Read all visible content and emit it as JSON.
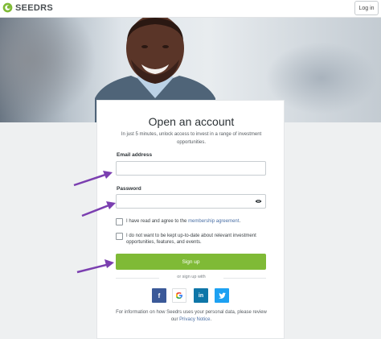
{
  "header": {
    "brand": "SEEDRS",
    "login_label": "Log in"
  },
  "form": {
    "title": "Open an account",
    "subtitle": "In just 5 minutes, unlock access to invest in a range of investment opportunities.",
    "email_label": "Email address",
    "email_value": "",
    "password_label": "Password",
    "password_value": "",
    "agree_text": "I have read and agree to the ",
    "agree_link": "membership agreement",
    "agree_end": ".",
    "optout_text": "I do not want to be kept up-to-date about relevant investment opportunities, features, and events.",
    "signup_label": "Sign up",
    "or_text": "or sign up with",
    "privacy_text": "For information on how Seedrs uses your personal data, please review our ",
    "privacy_link": "Privacy Notice",
    "privacy_end": "."
  },
  "social": {
    "facebook": "f",
    "google": "G",
    "linkedin": "in",
    "twitter": "twitter-icon"
  },
  "colors": {
    "brand_green": "#7fba36",
    "link": "#4a6fa5",
    "arrow": "#7b3fb0"
  }
}
